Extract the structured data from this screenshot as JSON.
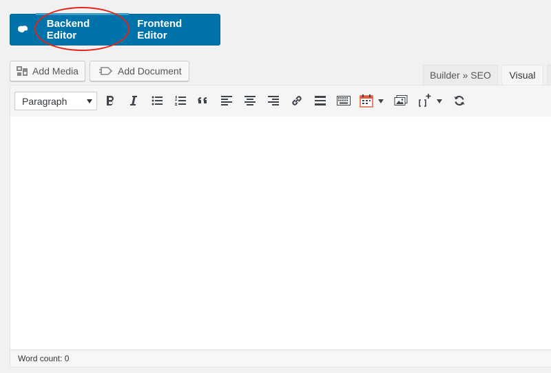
{
  "builder": {
    "backend_label": "Backend Editor",
    "frontend_label": "Frontend Editor",
    "accent": "#0073aa",
    "highlight": "#e3251b"
  },
  "media": {
    "add_media_label": "Add Media",
    "add_document_label": "Add Document"
  },
  "tabs": [
    {
      "label": "Builder » SEO"
    },
    {
      "label": "Visual"
    }
  ],
  "toolbar": {
    "format_value": "Paragraph",
    "icons": [
      "bold-icon",
      "italic-icon",
      "bullet-list-icon",
      "numbered-list-icon",
      "blockquote-icon",
      "align-left-icon",
      "align-center-icon",
      "align-right-icon",
      "link-icon",
      "read-more-icon",
      "toolbar-toggle-icon",
      "calendar-icon",
      "gallery-icon",
      "shortcode-icon",
      "refresh-icon"
    ]
  },
  "status": {
    "word_count": "Word count: 0"
  }
}
